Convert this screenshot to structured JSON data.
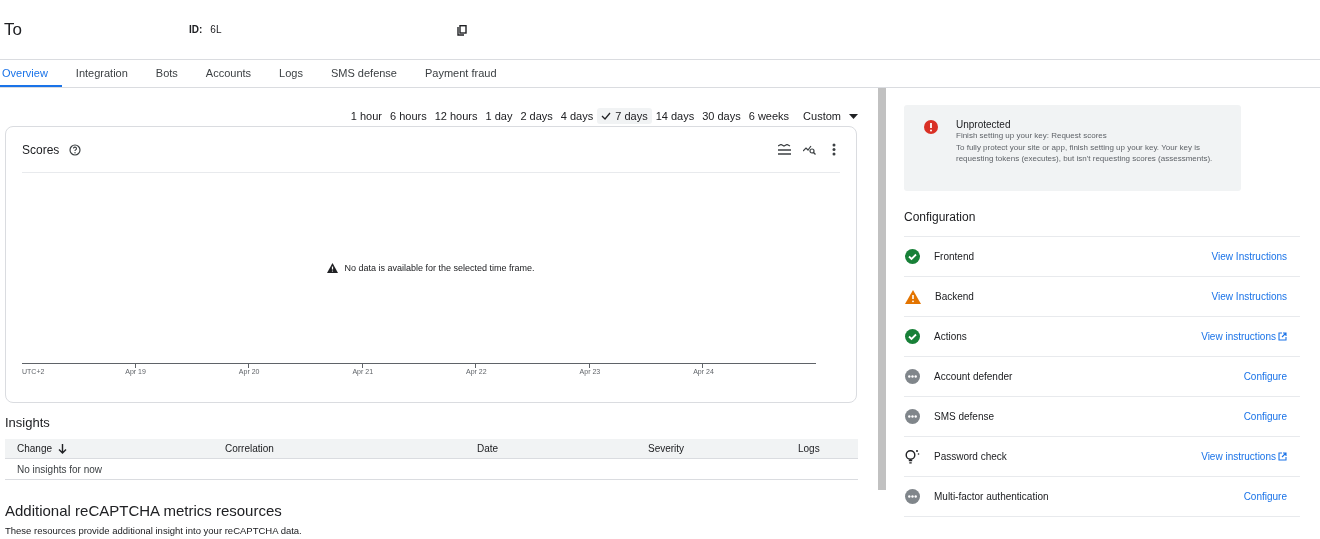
{
  "header": {
    "title": "To",
    "id_label": "ID:",
    "id_value": "6L"
  },
  "tabs": [
    {
      "label": "Overview",
      "selected": true
    },
    {
      "label": "Integration",
      "selected": false
    },
    {
      "label": "Bots",
      "selected": false
    },
    {
      "label": "Accounts",
      "selected": false
    },
    {
      "label": "Logs",
      "selected": false
    },
    {
      "label": "SMS defense",
      "selected": false
    },
    {
      "label": "Payment fraud",
      "selected": false
    }
  ],
  "time_ranges": [
    {
      "label": "1 hour",
      "selected": false
    },
    {
      "label": "6 hours",
      "selected": false
    },
    {
      "label": "12 hours",
      "selected": false
    },
    {
      "label": "1 day",
      "selected": false
    },
    {
      "label": "2 days",
      "selected": false
    },
    {
      "label": "4 days",
      "selected": false
    },
    {
      "label": "7 days",
      "selected": true
    },
    {
      "label": "14 days",
      "selected": false
    },
    {
      "label": "30 days",
      "selected": false
    },
    {
      "label": "6 weeks",
      "selected": false
    }
  ],
  "custom_range": "Custom",
  "scores_card": {
    "title": "Scores",
    "empty_message": "No data is available for the selected time frame.",
    "axis_labels": [
      "UTC+2",
      "Apr 19",
      "Apr 20",
      "Apr 21",
      "Apr 22",
      "Apr 23",
      "Apr 24"
    ]
  },
  "insights": {
    "title": "Insights",
    "columns": [
      "Change",
      "Correlation",
      "Date",
      "Severity",
      "Logs"
    ],
    "empty_message": "No insights for now"
  },
  "resources": {
    "title": "Additional reCAPTCHA metrics resources",
    "text": "These resources provide additional insight into your reCAPTCHA data."
  },
  "alert": {
    "title": "Unprotected",
    "subtitle": "Finish setting up your key: Request scores",
    "text": "To fully protect your site or app, finish setting up your key. Your key is requesting tokens (executes), but isn't requesting scores (assessments)."
  },
  "configuration": {
    "title": "Configuration",
    "items": [
      {
        "kind": "done",
        "label": "Frontend",
        "link": "View Instructions",
        "external": false
      },
      {
        "kind": "warning",
        "label": "Backend",
        "link": "View Instructions",
        "external": false
      },
      {
        "kind": "done",
        "label": "Actions",
        "link": "View instructions",
        "external": true
      },
      {
        "kind": "pending",
        "label": "Account defender",
        "link": "Configure",
        "external": false
      },
      {
        "kind": "pending",
        "label": "SMS defense",
        "link": "Configure",
        "external": false
      },
      {
        "kind": "tip",
        "label": "Password check",
        "link": "View instructions",
        "external": true
      },
      {
        "kind": "pending",
        "label": "Multi-factor authentication",
        "link": "Configure",
        "external": false
      }
    ]
  }
}
